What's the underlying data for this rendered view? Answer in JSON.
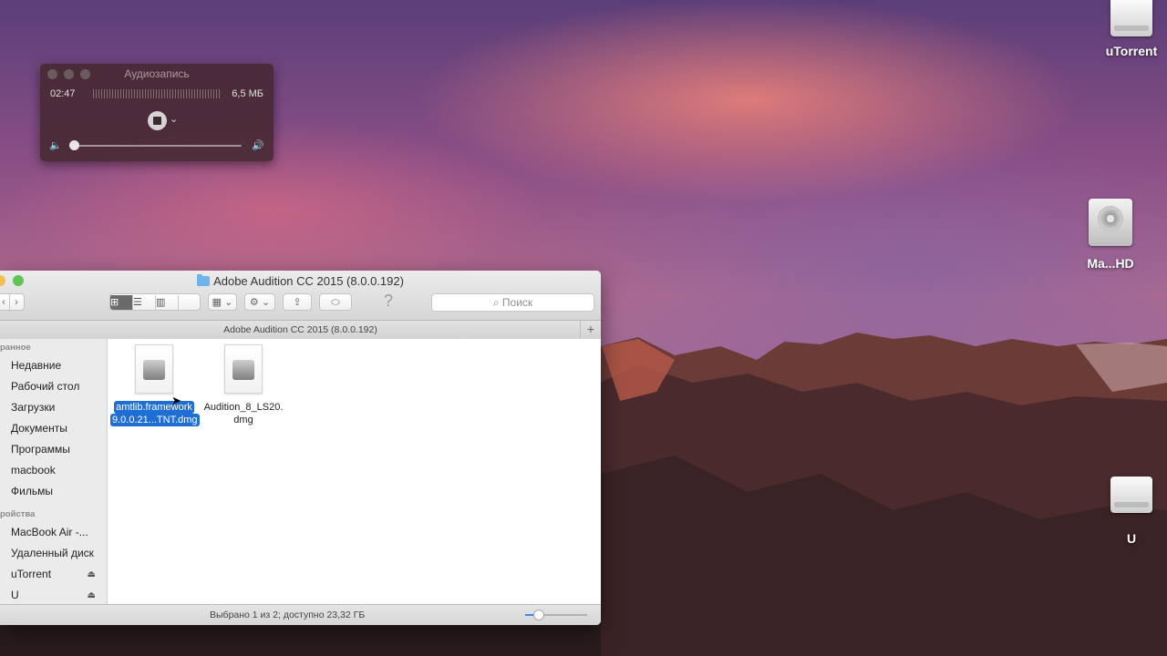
{
  "desktop": {
    "icons": [
      {
        "label": "uTorrent",
        "icon": "external-drive-icon"
      },
      {
        "label": "Ma...HD",
        "icon": "hard-drive-icon"
      },
      {
        "label": "U",
        "icon": "external-drive-icon"
      }
    ]
  },
  "recorder": {
    "title": "Аудиозапись",
    "elapsed": "02:47",
    "size": "6,5 МБ",
    "volume_level": 0.02
  },
  "finder": {
    "window_title": "Adobe Audition CC 2015 (8.0.0.192)",
    "path_title": "Adobe Audition CC 2015 (8.0.0.192)",
    "search_placeholder": "Поиск",
    "sidebar": {
      "favorites_header": "ранное",
      "favorites": [
        "Недавние",
        "Рабочий стол",
        "Загрузки",
        "Документы",
        "Программы",
        "macbook",
        "Фильмы"
      ],
      "devices_header": "ройства",
      "devices": [
        {
          "label": "MacBook Air -...",
          "eject": false
        },
        {
          "label": "Удаленный диск",
          "eject": false
        },
        {
          "label": "uTorrent",
          "eject": true
        },
        {
          "label": "U",
          "eject": true
        }
      ]
    },
    "files": [
      {
        "line1": "amtlib.framework",
        "line2": "9.0.0.21...TNT.dmg",
        "selected": true
      },
      {
        "line1": "Audition_8_LS20.",
        "line2": "dmg",
        "selected": false
      }
    ],
    "status": "Выбрано 1 из 2; доступно 23,32 ГБ",
    "icon_size_level": 0.2
  }
}
